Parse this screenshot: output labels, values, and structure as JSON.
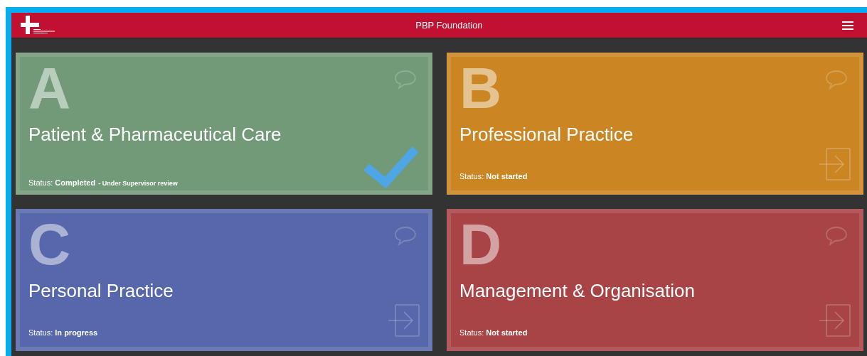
{
  "header": {
    "title": "PBP Foundation"
  },
  "cards": [
    {
      "letter": "A",
      "title": "Patient & Pharmaceutical Care",
      "status_label": "Status:",
      "status": "Completed",
      "note": "- Under Supervisor review",
      "completed": true,
      "color": "#729a78"
    },
    {
      "letter": "B",
      "title": "Professional Practice",
      "status_label": "Status:",
      "status": "Not started",
      "completed": false,
      "color": "#cb8623"
    },
    {
      "letter": "C",
      "title": "Personal Practice",
      "status_label": "Status:",
      "status": "In progress",
      "completed": false,
      "color": "#5767ab"
    },
    {
      "letter": "D",
      "title": "Management & Organisation",
      "status_label": "Status:",
      "status": "Not started",
      "completed": false,
      "color": "#a84446"
    }
  ]
}
